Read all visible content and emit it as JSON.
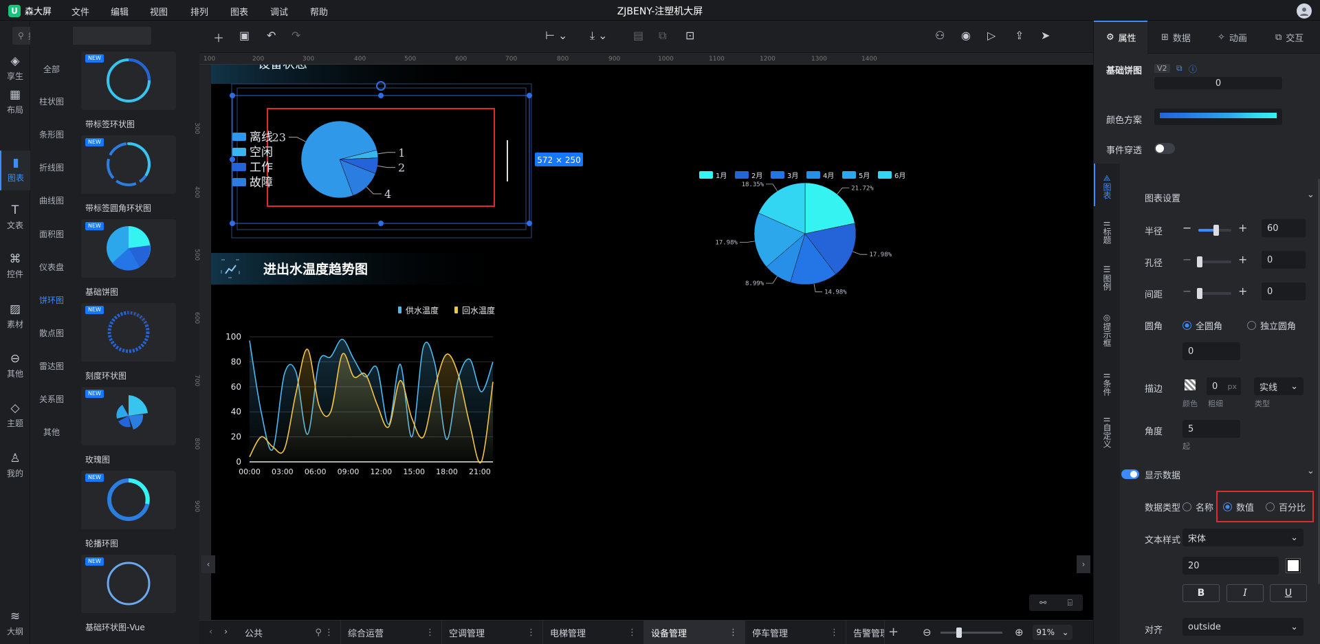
{
  "app": {
    "name": "森大屏",
    "title": "ZJBENY-注塑机大屏"
  },
  "menu": [
    "文件",
    "编辑",
    "视图",
    "排列",
    "图表",
    "调试",
    "帮助"
  ],
  "search": {
    "placeholder": "搜索"
  },
  "rail": [
    {
      "label": "享生",
      "icon": "diamond-icon"
    },
    {
      "label": "布局",
      "icon": "layout-icon"
    },
    {
      "label": "图表",
      "icon": "bar-chart-icon",
      "active": true
    },
    {
      "label": "文表",
      "icon": "text-icon"
    },
    {
      "label": "控件",
      "icon": "widget-icon"
    },
    {
      "label": "素材",
      "icon": "image-icon"
    },
    {
      "label": "其他",
      "icon": "more-icon"
    },
    {
      "label": "主题",
      "icon": "theme-icon"
    },
    {
      "label": "我的",
      "icon": "user-icon"
    },
    {
      "label": "大纲",
      "icon": "layers-icon"
    }
  ],
  "categories": [
    "全部",
    "柱状图",
    "条形图",
    "折线图",
    "曲线图",
    "面积图",
    "仪表盘",
    "饼环图",
    "散点图",
    "雷达图",
    "关系图",
    "其他"
  ],
  "active_category": "饼环图",
  "gallery": [
    {
      "label": "带标签环状图",
      "new": "NEW"
    },
    {
      "label": "带标签圆角环状图",
      "new": "NEW"
    },
    {
      "label": "基础饼图",
      "new": "NEW"
    },
    {
      "label": "刻度环状图",
      "new": "NEW"
    },
    {
      "label": "玫瑰图",
      "new": "NEW"
    },
    {
      "label": "轮播环图",
      "new": "NEW"
    },
    {
      "label": "基础环状图-Vue",
      "new": "NEW"
    }
  ],
  "ruler": {
    "h": [
      "100",
      "200",
      "300",
      "400",
      "500",
      "600",
      "700",
      "800",
      "900",
      "1000",
      "1100",
      "1200",
      "1300",
      "1400"
    ],
    "v": [
      "300",
      "400",
      "500",
      "600",
      "700",
      "800",
      "900"
    ]
  },
  "canvas": {
    "section_top_title": "设备状态",
    "section_title": "进出水温度趋势图",
    "size_badge": "572 × 250",
    "pie_small": {
      "legend": [
        "离线",
        "空闲",
        "工作",
        "故障"
      ],
      "labels": [
        "23",
        "1",
        "2",
        "4"
      ],
      "colors": [
        "#2f98e8",
        "#39b6f0",
        "#2563d8",
        "#2b7ee0"
      ]
    }
  },
  "chart_data": [
    {
      "type": "pie",
      "categories": [
        "离线",
        "空闲",
        "工作",
        "故障"
      ],
      "values": [
        23,
        1,
        2,
        4
      ]
    },
    {
      "type": "pie",
      "categories": [
        "1月",
        "2月",
        "3月",
        "4月",
        "5月",
        "6月"
      ],
      "values": [
        21.72,
        17.98,
        14.98,
        8.99,
        17.98,
        18.35
      ],
      "labels": [
        "21.72%",
        "17.98%",
        "14.98%",
        "8.99%",
        "17.98%",
        "18.35%"
      ],
      "colors": [
        "#35f3f0",
        "#2563d8",
        "#2476e6",
        "#288fe8",
        "#2ca7ec",
        "#33d6f2"
      ]
    },
    {
      "type": "line",
      "series": [
        {
          "name": "供水温度",
          "color": "#4fb8ef",
          "values": [
            97,
            40,
            10,
            70,
            72,
            22,
            80,
            84,
            98,
            82,
            68,
            75,
            30,
            78,
            20,
            92,
            78,
            18,
            66,
            82,
            56,
            80
          ]
        },
        {
          "name": "回水温度",
          "color": "#f4c545",
          "values": [
            4,
            20,
            12,
            10,
            55,
            90,
            45,
            40,
            86,
            68,
            70,
            46,
            28,
            65,
            35,
            20,
            60,
            86,
            70,
            30,
            0,
            64
          ]
        }
      ],
      "x_ticks": [
        "00:00",
        "03:00",
        "06:00",
        "09:00",
        "12:00",
        "15:00",
        "18:00",
        "21:00"
      ],
      "y_ticks": [
        "100",
        "80",
        "60",
        "40",
        "20",
        "0"
      ],
      "ylim": [
        0,
        100
      ]
    }
  ],
  "tabs": [
    {
      "label": "公共"
    },
    {
      "label": "综合运营"
    },
    {
      "label": "空调管理"
    },
    {
      "label": "电梯管理"
    },
    {
      "label": "设备管理",
      "active": true
    },
    {
      "label": "停车管理"
    },
    {
      "label": "告警管理"
    }
  ],
  "zoom": {
    "value": "91%"
  },
  "panel": {
    "tabs": [
      "属性",
      "数据",
      "动画",
      "交互"
    ],
    "component_name": "基础饼图",
    "version": "V2",
    "top_value": "0",
    "color_scheme_label": "颜色方案",
    "event_passthrough_label": "事件穿透",
    "vtabs": [
      "图表",
      "标题",
      "图例",
      "提示框",
      "条件",
      "自定义"
    ],
    "chart_settings": "图表设置",
    "radius": {
      "label": "半径",
      "value": "60",
      "level": 0.55
    },
    "hole": {
      "label": "孔径",
      "value": "0",
      "level": 0.05
    },
    "gap": {
      "label": "间距",
      "value": "0",
      "level": 0.05
    },
    "corner": {
      "label": "圆角",
      "opt1": "全圆角",
      "opt2": "独立圆角",
      "value": "0"
    },
    "border": {
      "label": "描边",
      "width": "0",
      "unit": "px",
      "style": "实线",
      "sub_color": "颜色",
      "sub_width": "粗细",
      "sub_type": "类型"
    },
    "angle": {
      "label": "角度",
      "value": "5",
      "sub": "起"
    },
    "show_data": "显示数据",
    "data_type": {
      "label": "数据类型",
      "opt_name": "名称",
      "opt_value": "数值",
      "opt_percent": "百分比"
    },
    "text_style": {
      "label": "文本样式",
      "font": "宋体",
      "size": "20"
    },
    "format_buttons": [
      "B",
      "I",
      "U"
    ],
    "align": {
      "label": "对齐",
      "value": "outside"
    }
  }
}
